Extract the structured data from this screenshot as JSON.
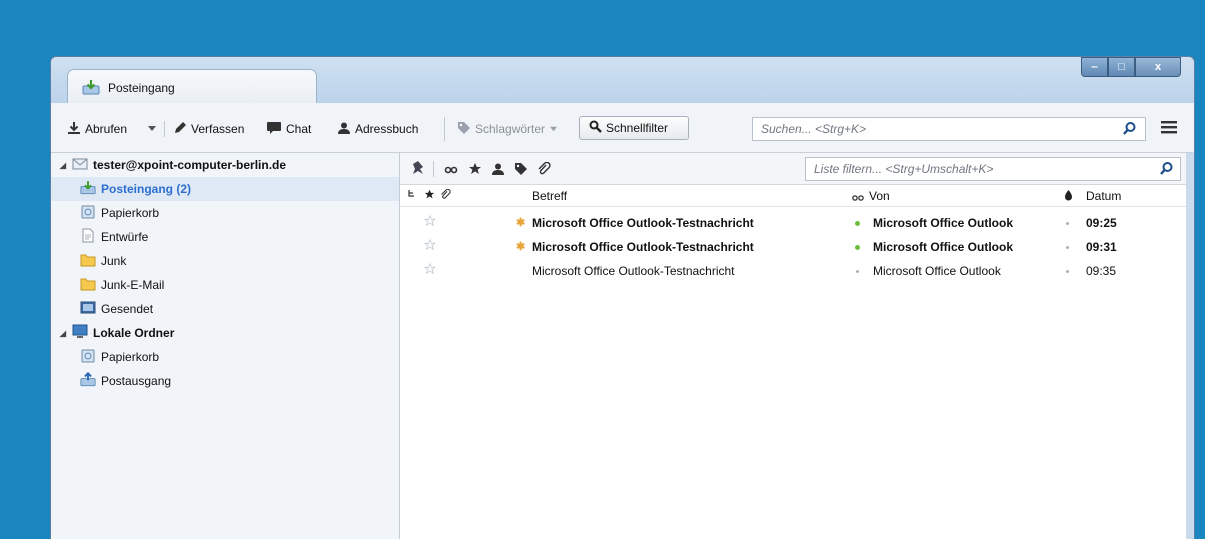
{
  "window": {
    "tab_label": "Posteingang",
    "controls": {
      "minimize": "‒",
      "maximize": "□",
      "close": "x"
    }
  },
  "toolbar": {
    "get_messages": "Abrufen",
    "compose": "Verfassen",
    "chat": "Chat",
    "address_book": "Adressbuch",
    "tags": "Schlagwörter",
    "quick_filter": "Schnellfilter",
    "search_placeholder": "Suchen... <Strg+K>"
  },
  "folders": {
    "account": "tester@xpoint-computer-berlin.de",
    "account_folders": [
      {
        "label": "Posteingang (2)",
        "icon": "inbox-icon",
        "selected": true
      },
      {
        "label": "Papierkorb",
        "icon": "trash-icon"
      },
      {
        "label": "Entwürfe",
        "icon": "drafts-icon"
      },
      {
        "label": "Junk",
        "icon": "folder-icon"
      },
      {
        "label": "Junk-E-Mail",
        "icon": "folder-icon"
      },
      {
        "label": "Gesendet",
        "icon": "sent-icon"
      }
    ],
    "local": "Lokale Ordner",
    "local_folders": [
      {
        "label": "Papierkorb",
        "icon": "trash-icon"
      },
      {
        "label": "Postausgang",
        "icon": "outbox-icon"
      }
    ]
  },
  "quickfilter": {
    "placeholder": "Liste filtern... <Strg+Umschalt+K>"
  },
  "columns": {
    "subject": "Betreff",
    "from": "Von",
    "date": "Datum"
  },
  "messages": [
    {
      "subject": "Microsoft Office Outlook-Testnachricht",
      "from": "Microsoft Office Outlook",
      "date": "09:25",
      "unread": true
    },
    {
      "subject": "Microsoft Office Outlook-Testnachricht",
      "from": "Microsoft Office Outlook",
      "date": "09:31",
      "unread": true
    },
    {
      "subject": "Microsoft Office Outlook-Testnachricht",
      "from": "Microsoft Office Outlook",
      "date": "09:35",
      "unread": false
    }
  ],
  "colors": {
    "desktop": "#1a86bf",
    "selected_text": "#2d6fd1",
    "unread_star": "#e8a33a",
    "online_dot": "#6cbf3c"
  }
}
